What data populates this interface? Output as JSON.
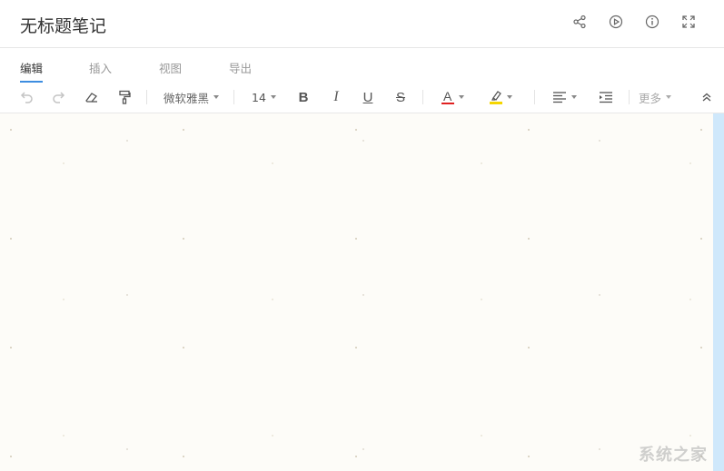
{
  "note": {
    "title": "无标题笔记"
  },
  "header_icons": [
    "share-icon",
    "play-icon",
    "info-icon",
    "fullscreen-icon"
  ],
  "tabs": [
    {
      "label": "编辑",
      "active": true
    },
    {
      "label": "插入",
      "active": false
    },
    {
      "label": "视图",
      "active": false
    },
    {
      "label": "导出",
      "active": false
    }
  ],
  "toolbar": {
    "font_family": "微软雅黑",
    "font_size": "14",
    "bold_label": "B",
    "italic_label": "I",
    "underline_label": "U",
    "strike_label": "S",
    "font_color_label": "A",
    "more_label": "更多"
  },
  "colors": {
    "accent": "#3d8de0",
    "font_color_bar": "#e02020",
    "highlight_bar": "#f5d600",
    "scrollbar": "#cfe8fb"
  },
  "watermark": "系统之家"
}
